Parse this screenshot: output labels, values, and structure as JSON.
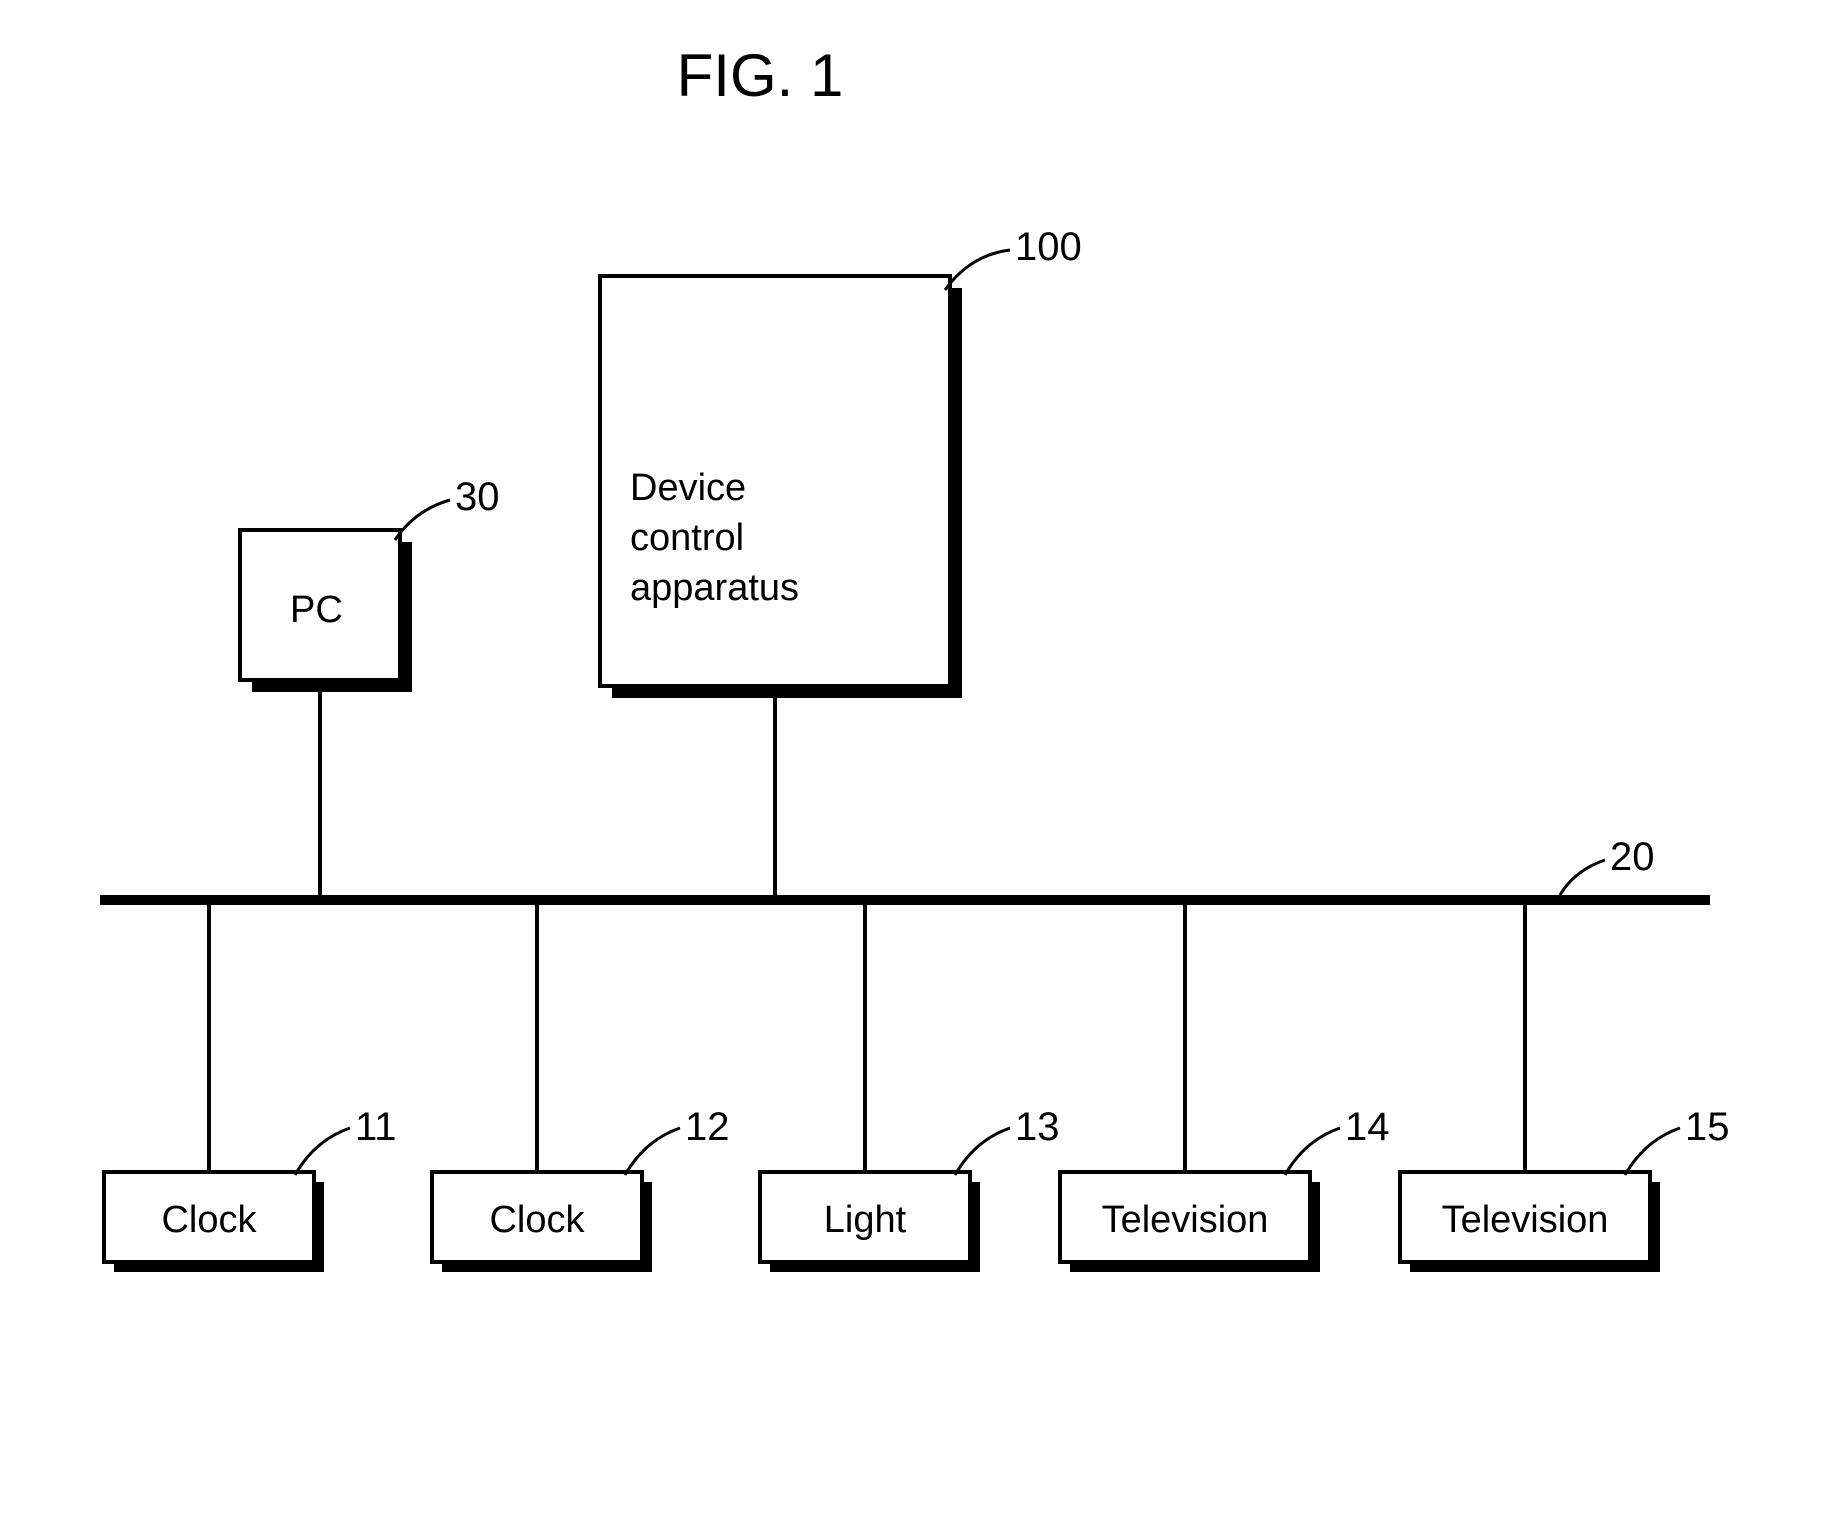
{
  "title": "FIG. 1",
  "nodes": {
    "pc": {
      "label": "PC",
      "ref": "30"
    },
    "dca": {
      "label": "Device\ncontrol\napparatus",
      "ref": "100"
    },
    "bus": {
      "ref": "20"
    },
    "clock1": {
      "label": "Clock",
      "ref": "11"
    },
    "clock2": {
      "label": "Clock",
      "ref": "12"
    },
    "light": {
      "label": "Light",
      "ref": "13"
    },
    "tv1": {
      "label": "Television",
      "ref": "14"
    },
    "tv2": {
      "label": "Television",
      "ref": "15"
    }
  }
}
